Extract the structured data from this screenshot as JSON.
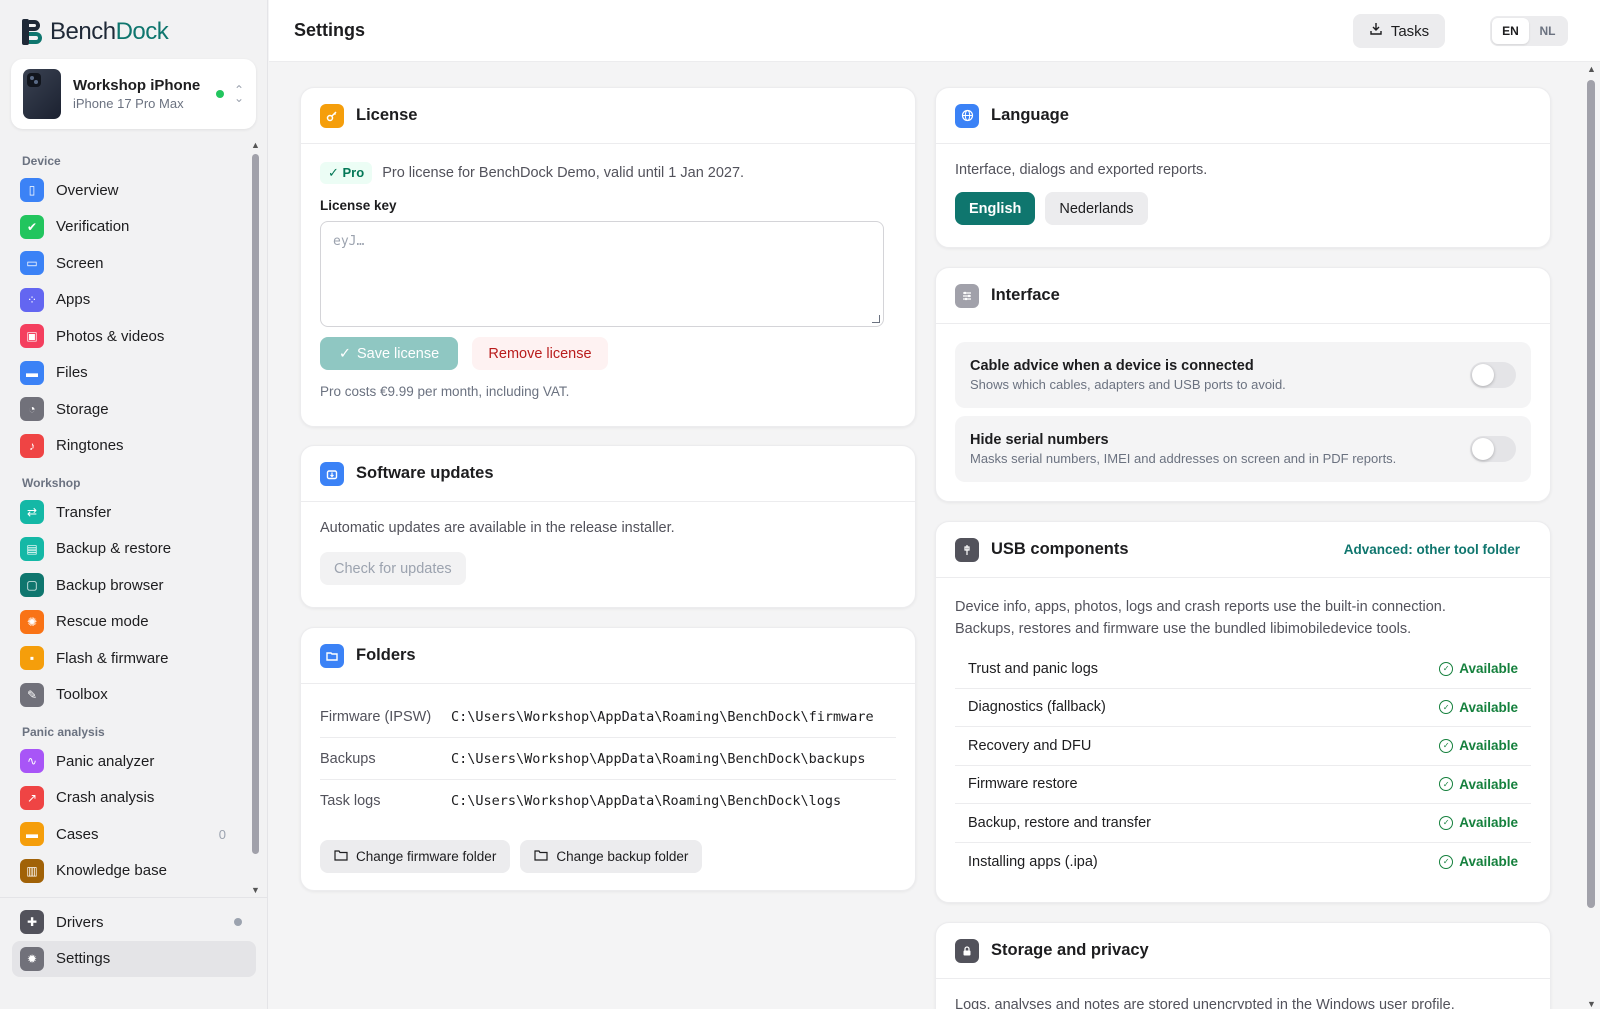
{
  "app": {
    "name_bench": "Bench",
    "name_dock": "Dock"
  },
  "device": {
    "name": "Workshop iPhone",
    "model": "iPhone 17 Pro Max"
  },
  "nav": {
    "sections": [
      {
        "title": "Device",
        "items": [
          {
            "label": "Overview",
            "icon": "phone-icon",
            "color": "#3b82f6"
          },
          {
            "label": "Verification",
            "icon": "shield-icon",
            "color": "#22c55e"
          },
          {
            "label": "Screen",
            "icon": "screen-icon",
            "color": "#3b82f6"
          },
          {
            "label": "Apps",
            "icon": "grid-icon",
            "color": "#6366f1"
          },
          {
            "label": "Photos & videos",
            "icon": "photo-icon",
            "color": "#f43f5e"
          },
          {
            "label": "Files",
            "icon": "folder-icon",
            "color": "#3b82f6"
          },
          {
            "label": "Storage",
            "icon": "pie-icon",
            "color": "#71717a"
          },
          {
            "label": "Ringtones",
            "icon": "music-icon",
            "color": "#ef4444"
          }
        ]
      },
      {
        "title": "Workshop",
        "items": [
          {
            "label": "Transfer",
            "icon": "swap-icon",
            "color": "#14b8a6"
          },
          {
            "label": "Backup & restore",
            "icon": "archive-icon",
            "color": "#14b8a6"
          },
          {
            "label": "Backup browser",
            "icon": "browser-icon",
            "color": "#0f766e"
          },
          {
            "label": "Rescue mode",
            "icon": "lifebuoy-icon",
            "color": "#f97316"
          },
          {
            "label": "Flash & firmware",
            "icon": "chip-icon",
            "color": "#f59e0b"
          },
          {
            "label": "Toolbox",
            "icon": "wrench-icon",
            "color": "#71717a"
          }
        ]
      },
      {
        "title": "Panic analysis",
        "items": [
          {
            "label": "Panic analyzer",
            "icon": "pulse-icon",
            "color": "#a855f7"
          },
          {
            "label": "Crash analysis",
            "icon": "chart-icon",
            "color": "#ef4444"
          },
          {
            "label": "Cases",
            "icon": "folder-icon",
            "color": "#f59e0b",
            "badge": "0"
          },
          {
            "label": "Knowledge base",
            "icon": "book-icon",
            "color": "#a16207"
          }
        ]
      }
    ],
    "bottom": [
      {
        "label": "Drivers",
        "icon": "puzzle-icon",
        "color": "#52525b"
      },
      {
        "label": "Settings",
        "icon": "gear-icon",
        "color": "#71717a"
      }
    ]
  },
  "topbar": {
    "title": "Settings",
    "tasks_label": "Tasks",
    "lang_en": "EN",
    "lang_nl": "NL"
  },
  "license": {
    "title": "License",
    "badge": "Pro",
    "status": "Pro license for BenchDock Demo, valid until 1 Jan 2027.",
    "key_label": "License key",
    "key_placeholder": "eyJ…",
    "save_label": "Save license",
    "remove_label": "Remove license",
    "price_note": "Pro costs €9.99 per month, including VAT."
  },
  "updates": {
    "title": "Software updates",
    "text": "Automatic updates are available in the release installer.",
    "check_label": "Check for updates"
  },
  "folders": {
    "title": "Folders",
    "rows": [
      {
        "label": "Firmware (IPSW)",
        "path": "C:\\Users\\Workshop\\AppData\\Roaming\\BenchDock\\firmware"
      },
      {
        "label": "Backups",
        "path": "C:\\Users\\Workshop\\AppData\\Roaming\\BenchDock\\backups"
      },
      {
        "label": "Task logs",
        "path": "C:\\Users\\Workshop\\AppData\\Roaming\\BenchDock\\logs"
      }
    ],
    "change_firmware_label": "Change firmware folder",
    "change_backup_label": "Change backup folder"
  },
  "language": {
    "title": "Language",
    "text": "Interface, dialogs and exported reports.",
    "english_label": "English",
    "dutch_label": "Nederlands"
  },
  "interface": {
    "title": "Interface",
    "toggles": [
      {
        "title": "Cable advice when a device is connected",
        "sub": "Shows which cables, adapters and USB ports to avoid.",
        "on": false
      },
      {
        "title": "Hide serial numbers",
        "sub": "Masks serial numbers, IMEI and addresses on screen and in PDF reports.",
        "on": false
      }
    ]
  },
  "usb": {
    "title": "USB components",
    "advanced_link": "Advanced: other tool folder",
    "text1": "Device info, apps, photos, logs and crash reports use the built-in connection.",
    "text2": "Backups, restores and firmware use the bundled libimobiledevice tools.",
    "components": [
      {
        "name": "Trust and panic logs",
        "status": "Available"
      },
      {
        "name": "Diagnostics (fallback)",
        "status": "Available"
      },
      {
        "name": "Recovery and DFU",
        "status": "Available"
      },
      {
        "name": "Firmware restore",
        "status": "Available"
      },
      {
        "name": "Backup, restore and transfer",
        "status": "Available"
      },
      {
        "name": "Installing apps (.ipa)",
        "status": "Available"
      }
    ]
  },
  "storage": {
    "title": "Storage and privacy",
    "text": "Logs, analyses and notes are stored unencrypted in the Windows user profile."
  },
  "colors": {
    "accent": "#0f766e",
    "success": "#15803d",
    "danger": "#b91c1c"
  }
}
